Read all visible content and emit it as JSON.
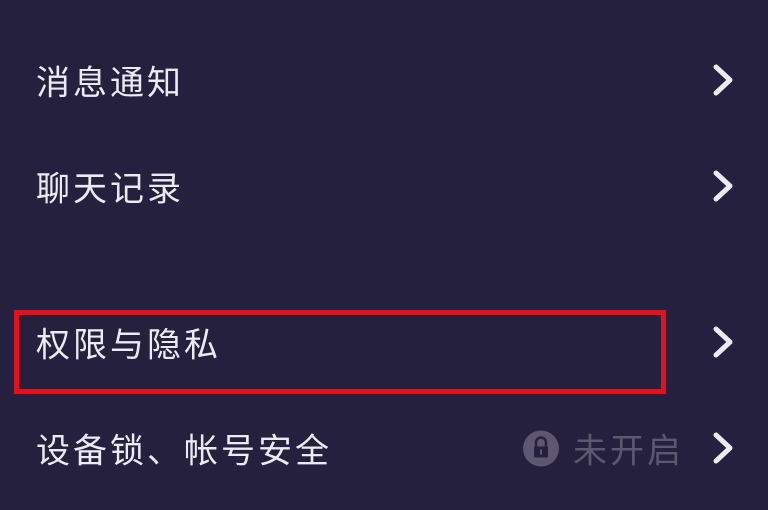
{
  "menu": {
    "items": [
      {
        "label": "消息通知"
      },
      {
        "label": "聊天记录"
      },
      {
        "label": "权限与隐私"
      },
      {
        "label": "设备锁、帐号安全",
        "status": "未开启"
      }
    ]
  },
  "colors": {
    "background": "#25203d",
    "text": "#eceaf3",
    "muted": "#5d586f",
    "highlight": "#e4101a"
  },
  "icons": {
    "chevron": "chevron-right-icon",
    "status": "lock-icon"
  }
}
